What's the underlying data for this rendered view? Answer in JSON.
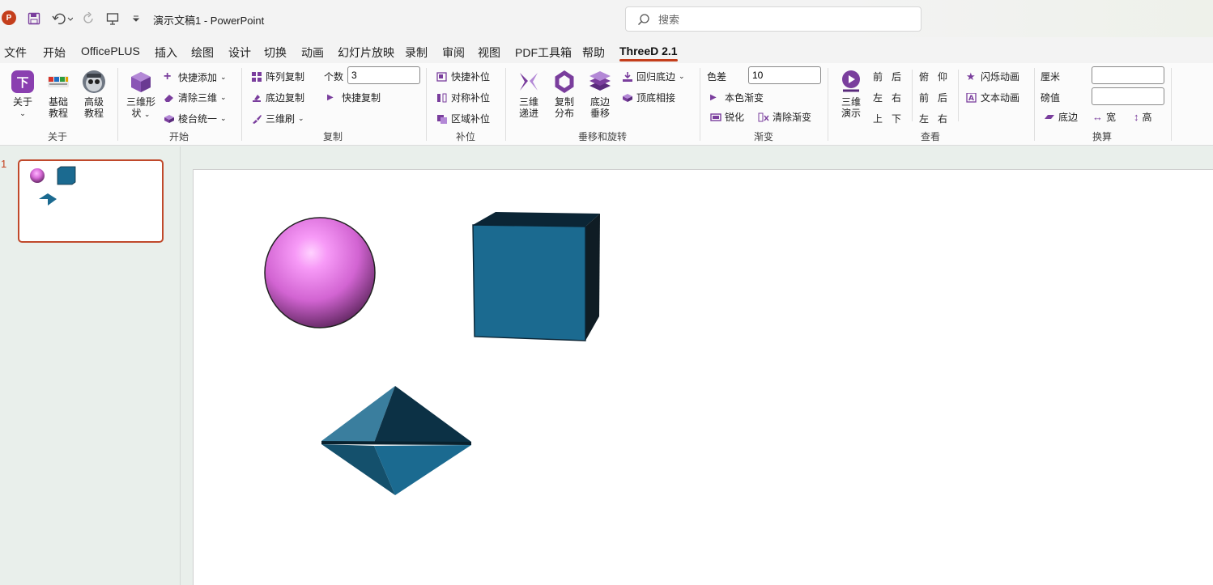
{
  "titlebar": {
    "doc_title": "演示文稿1  -  PowerPoint",
    "search_placeholder": "搜索"
  },
  "menu": [
    "文件",
    "开始",
    "OfficePLUS",
    "插入",
    "绘图",
    "设计",
    "切换",
    "动画",
    "幻灯片放映",
    "录制",
    "审阅",
    "视图",
    "PDF工具箱",
    "帮助",
    "ThreeD 2.1"
  ],
  "ribbon": {
    "about": {
      "about": "关于",
      "basic_tutorial": [
        "基础",
        "教程"
      ],
      "advanced_tutorial": [
        "高级",
        "教程"
      ],
      "group": "关于"
    },
    "start": {
      "shape": [
        "三维形",
        "状"
      ],
      "quick_add": "快捷添加",
      "clear_3d": "清除三维",
      "bevel_unify": "棱台统一",
      "group": "开始"
    },
    "copy": {
      "array_copy": "阵列复制",
      "base_copy": "底边复制",
      "brush_3d": "三维刷",
      "count_label": "个数",
      "count_value": "3",
      "quick_copy": "快捷复制",
      "group": "复制"
    },
    "fill": {
      "quick_fill": "快捷补位",
      "sym_fill": "对称补位",
      "area_fill": "区域补位",
      "group": "补位"
    },
    "move": {
      "progression": [
        "三维",
        "递进"
      ],
      "distribute": [
        "复制",
        "分布"
      ],
      "base_vertical": [
        "底边",
        "垂移"
      ],
      "return_base": "回归底边",
      "top_base": "顶底相接",
      "group": "垂移和旋转"
    },
    "gradient": {
      "diff_label": "色差",
      "diff_value": "10",
      "same_color": "本色渐变",
      "sharpen": "锐化",
      "clear_grad": "清除渐变",
      "group": "渐变"
    },
    "view": {
      "demo": [
        "三维",
        "演示"
      ],
      "front": "前",
      "back": "后",
      "left": "左",
      "right": "右",
      "up": "上",
      "down": "下",
      "top_view": "俯",
      "bottom_view": "仰",
      "front2": "前",
      "back2": "后",
      "left2": "左",
      "right2": "右",
      "flash_anim": "闪烁动画",
      "text_anim": "文本动画",
      "group": "查看"
    },
    "convert": {
      "cm_label": "厘米",
      "pound_label": "磅值",
      "base": "底边",
      "width": "宽",
      "height": "高",
      "group": "换算"
    }
  },
  "slides": {
    "number": "1"
  },
  "colors": {
    "accent": "#c43e1c",
    "ribbon_icon": "#7a3e9d",
    "cube": "#1b6a90",
    "sphere": "#e070e0"
  }
}
